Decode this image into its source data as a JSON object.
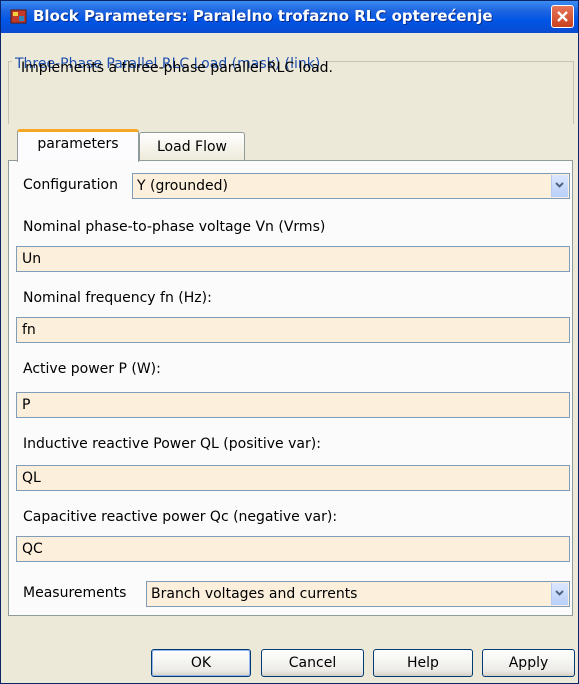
{
  "window": {
    "title": "Block Parameters: Paralelno trofazno RLC opterećenje"
  },
  "groupbox": {
    "legend": "Three-Phase Parallel RLC Load (mask) (link)",
    "description": "Implements a three-phase parallel RLC load."
  },
  "tabs": [
    {
      "label": "parameters",
      "active": true
    },
    {
      "label": "Load Flow",
      "active": false
    }
  ],
  "parameters": {
    "configuration": {
      "label": "Configuration",
      "value": "Y (grounded)"
    },
    "voltage": {
      "label": "Nominal phase-to-phase voltage Vn (Vrms)",
      "value": "Un"
    },
    "frequency": {
      "label": "Nominal frequency fn (Hz):",
      "value": "fn"
    },
    "active_power": {
      "label": "Active power P (W):",
      "value": "P"
    },
    "inductive_power": {
      "label": "Inductive reactive Power QL (positive var):",
      "value": "QL"
    },
    "capacitive_power": {
      "label": "Capacitive reactive power Qc (negative var):",
      "value": "QC"
    },
    "measurements": {
      "label": "Measurements",
      "value": "Branch voltages and currents"
    }
  },
  "buttons": {
    "ok": "OK",
    "cancel": "Cancel",
    "help": "Help",
    "apply": "Apply"
  },
  "icons": {
    "app": "simulink-block-icon",
    "close": "close-icon",
    "dropdown": "chevron-down-icon"
  },
  "colors": {
    "titlebar": "#0055e5",
    "close_button": "#d9532c",
    "field_background": "#fcf0dc",
    "active_tab_accent": "#f5a623",
    "legend_text": "#1f4fad"
  }
}
